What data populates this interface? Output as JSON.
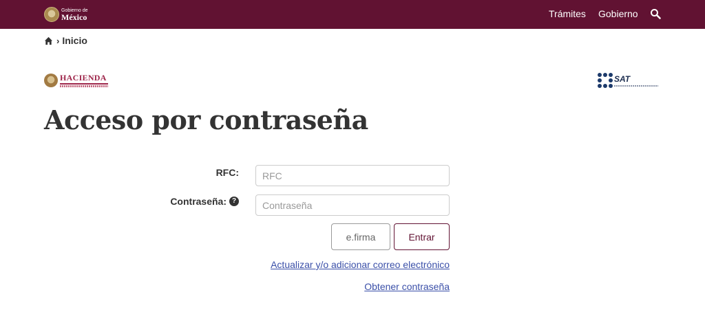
{
  "header": {
    "logo_small": "Gobierno de",
    "logo_big": "México",
    "nav": [
      {
        "label": "Trámites"
      },
      {
        "label": "Gobierno"
      }
    ],
    "search_icon": "search-icon"
  },
  "breadcrumb": {
    "home_icon": "home-icon",
    "separator": "›",
    "current": "Inicio"
  },
  "logos": {
    "hacienda": "HACIENDA",
    "sat": "SAT"
  },
  "page_title": "Acceso por contraseña",
  "form": {
    "rfc_label": "RFC:",
    "rfc_placeholder": "RFC",
    "rfc_value": "",
    "password_label": "Contraseña:",
    "password_help_icon": "question-circle-icon",
    "password_placeholder": "Contraseña",
    "password_value": "",
    "efirma_button": "e.firma",
    "entrar_button": "Entrar"
  },
  "links": {
    "update_email": "Actualizar y/o adicionar correo electrónico",
    "get_password": "Obtener contraseña"
  },
  "colors": {
    "brand": "#611232",
    "link": "#3a4fa8",
    "hacienda": "#9d2449"
  }
}
